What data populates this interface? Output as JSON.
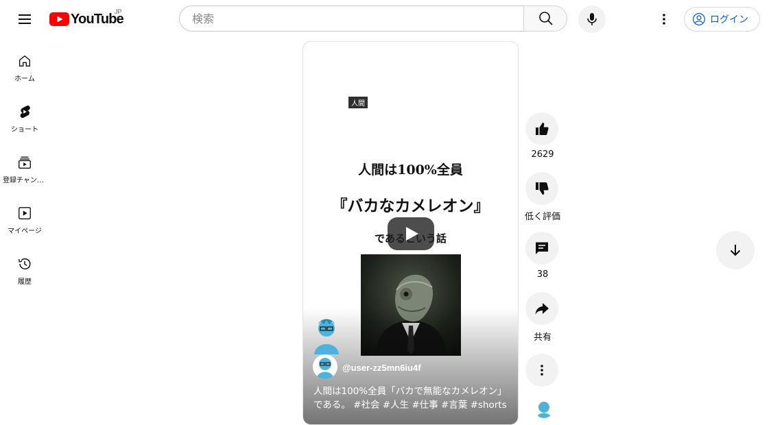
{
  "header": {
    "logo_text": "YouTube",
    "country_code": "JP",
    "search_placeholder": "検索",
    "login_label": "ログイン"
  },
  "sidebar": {
    "items": [
      {
        "label": "ホーム",
        "icon": "home-icon"
      },
      {
        "label": "ショート",
        "icon": "shorts-icon"
      },
      {
        "label": "登録チャンネル",
        "icon": "subscriptions-icon"
      },
      {
        "label": "マイページ",
        "icon": "you-icon"
      },
      {
        "label": "履歴",
        "icon": "history-icon"
      }
    ]
  },
  "video": {
    "frame_tag": "人間",
    "headline_1": "人間は100%全員",
    "headline_2": "『バカなカメレオン』",
    "headline_3": "であるという話",
    "channel_handle": "@user-zz5mn6iu4f",
    "caption": "人間は100%全員「バカで無能なカメレオン」である。 #社会 #人生 #仕事 #言葉 #shorts"
  },
  "actions": {
    "like_count": "2629",
    "dislike_label": "低く評価",
    "comment_count": "38",
    "share_label": "共有"
  },
  "colors": {
    "brand_red": "#ff0000",
    "link_blue": "#065fd4",
    "button_gray": "#f2f2f2"
  }
}
